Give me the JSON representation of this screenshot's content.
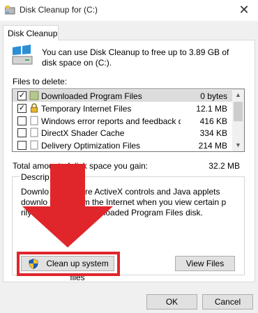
{
  "window": {
    "title": "Disk Cleanup for  (C:)",
    "close_glyph": "✕"
  },
  "tab": {
    "label": "Disk Cleanup"
  },
  "intro": {
    "text": "You can use Disk Cleanup to free up to 3.89 GB of disk space on  (C:)."
  },
  "files": {
    "label": "Files to delete:",
    "items": [
      {
        "name": "Downloaded Program Files",
        "size": "0 bytes",
        "checked": true,
        "icon": "folder-icon"
      },
      {
        "name": "Temporary Internet Files",
        "size": "12.1 MB",
        "checked": true,
        "icon": "lock-icon"
      },
      {
        "name": "Windows error reports and feedback di...",
        "size": "416 KB",
        "checked": false,
        "icon": "document-icon"
      },
      {
        "name": "DirectX Shader Cache",
        "size": "334 KB",
        "checked": false,
        "icon": "document-icon"
      },
      {
        "name": "Delivery Optimization Files",
        "size": "214 MB",
        "checked": false,
        "icon": "document-icon"
      }
    ]
  },
  "total": {
    "label": "Total amount of disk space you gain:",
    "value": "32.2 MB"
  },
  "description": {
    "legend": "Descrip",
    "text": "Downlo        m Files are ActiveX controls and Java applets downlo        tically from the Internet when you view certain p           rily stored in the Downloaded Program Files          disk."
  },
  "buttons": {
    "cleanup_label": "Clean up system files",
    "view_label": "View Files",
    "ok_label": "OK",
    "cancel_label": "Cancel"
  },
  "colors": {
    "annotation_red": "#e0262b",
    "shield_blue": "#1d5fb8",
    "shield_yellow": "#f2c230"
  }
}
